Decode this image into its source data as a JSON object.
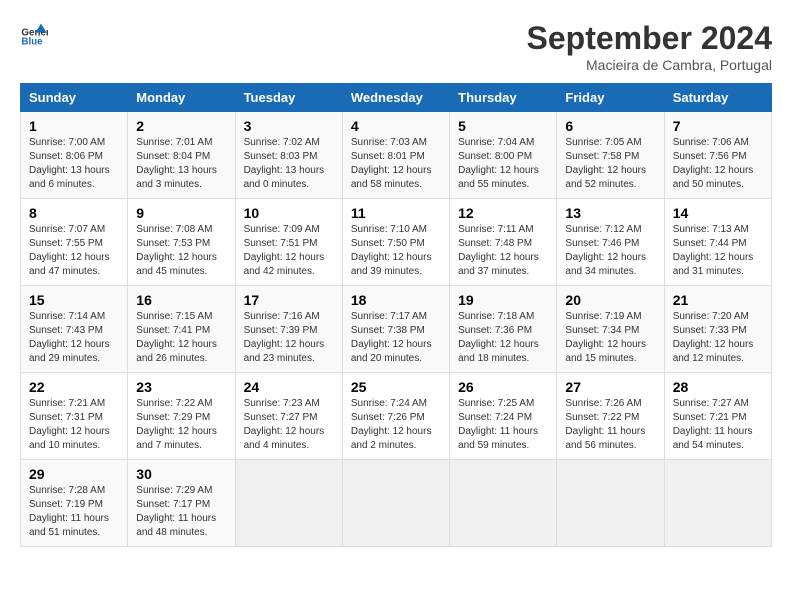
{
  "logo": {
    "line1": "General",
    "line2": "Blue"
  },
  "title": "September 2024",
  "subtitle": "Macieira de Cambra, Portugal",
  "weekdays": [
    "Sunday",
    "Monday",
    "Tuesday",
    "Wednesday",
    "Thursday",
    "Friday",
    "Saturday"
  ],
  "weeks": [
    [
      {
        "day": "1",
        "sunrise": "7:00 AM",
        "sunset": "8:06 PM",
        "daylight": "13 hours and 6 minutes."
      },
      {
        "day": "2",
        "sunrise": "7:01 AM",
        "sunset": "8:04 PM",
        "daylight": "13 hours and 3 minutes."
      },
      {
        "day": "3",
        "sunrise": "7:02 AM",
        "sunset": "8:03 PM",
        "daylight": "13 hours and 0 minutes."
      },
      {
        "day": "4",
        "sunrise": "7:03 AM",
        "sunset": "8:01 PM",
        "daylight": "12 hours and 58 minutes."
      },
      {
        "day": "5",
        "sunrise": "7:04 AM",
        "sunset": "8:00 PM",
        "daylight": "12 hours and 55 minutes."
      },
      {
        "day": "6",
        "sunrise": "7:05 AM",
        "sunset": "7:58 PM",
        "daylight": "12 hours and 52 minutes."
      },
      {
        "day": "7",
        "sunrise": "7:06 AM",
        "sunset": "7:56 PM",
        "daylight": "12 hours and 50 minutes."
      }
    ],
    [
      {
        "day": "8",
        "sunrise": "7:07 AM",
        "sunset": "7:55 PM",
        "daylight": "12 hours and 47 minutes."
      },
      {
        "day": "9",
        "sunrise": "7:08 AM",
        "sunset": "7:53 PM",
        "daylight": "12 hours and 45 minutes."
      },
      {
        "day": "10",
        "sunrise": "7:09 AM",
        "sunset": "7:51 PM",
        "daylight": "12 hours and 42 minutes."
      },
      {
        "day": "11",
        "sunrise": "7:10 AM",
        "sunset": "7:50 PM",
        "daylight": "12 hours and 39 minutes."
      },
      {
        "day": "12",
        "sunrise": "7:11 AM",
        "sunset": "7:48 PM",
        "daylight": "12 hours and 37 minutes."
      },
      {
        "day": "13",
        "sunrise": "7:12 AM",
        "sunset": "7:46 PM",
        "daylight": "12 hours and 34 minutes."
      },
      {
        "day": "14",
        "sunrise": "7:13 AM",
        "sunset": "7:44 PM",
        "daylight": "12 hours and 31 minutes."
      }
    ],
    [
      {
        "day": "15",
        "sunrise": "7:14 AM",
        "sunset": "7:43 PM",
        "daylight": "12 hours and 29 minutes."
      },
      {
        "day": "16",
        "sunrise": "7:15 AM",
        "sunset": "7:41 PM",
        "daylight": "12 hours and 26 minutes."
      },
      {
        "day": "17",
        "sunrise": "7:16 AM",
        "sunset": "7:39 PM",
        "daylight": "12 hours and 23 minutes."
      },
      {
        "day": "18",
        "sunrise": "7:17 AM",
        "sunset": "7:38 PM",
        "daylight": "12 hours and 20 minutes."
      },
      {
        "day": "19",
        "sunrise": "7:18 AM",
        "sunset": "7:36 PM",
        "daylight": "12 hours and 18 minutes."
      },
      {
        "day": "20",
        "sunrise": "7:19 AM",
        "sunset": "7:34 PM",
        "daylight": "12 hours and 15 minutes."
      },
      {
        "day": "21",
        "sunrise": "7:20 AM",
        "sunset": "7:33 PM",
        "daylight": "12 hours and 12 minutes."
      }
    ],
    [
      {
        "day": "22",
        "sunrise": "7:21 AM",
        "sunset": "7:31 PM",
        "daylight": "12 hours and 10 minutes."
      },
      {
        "day": "23",
        "sunrise": "7:22 AM",
        "sunset": "7:29 PM",
        "daylight": "12 hours and 7 minutes."
      },
      {
        "day": "24",
        "sunrise": "7:23 AM",
        "sunset": "7:27 PM",
        "daylight": "12 hours and 4 minutes."
      },
      {
        "day": "25",
        "sunrise": "7:24 AM",
        "sunset": "7:26 PM",
        "daylight": "12 hours and 2 minutes."
      },
      {
        "day": "26",
        "sunrise": "7:25 AM",
        "sunset": "7:24 PM",
        "daylight": "11 hours and 59 minutes."
      },
      {
        "day": "27",
        "sunrise": "7:26 AM",
        "sunset": "7:22 PM",
        "daylight": "11 hours and 56 minutes."
      },
      {
        "day": "28",
        "sunrise": "7:27 AM",
        "sunset": "7:21 PM",
        "daylight": "11 hours and 54 minutes."
      }
    ],
    [
      {
        "day": "29",
        "sunrise": "7:28 AM",
        "sunset": "7:19 PM",
        "daylight": "11 hours and 51 minutes."
      },
      {
        "day": "30",
        "sunrise": "7:29 AM",
        "sunset": "7:17 PM",
        "daylight": "11 hours and 48 minutes."
      },
      null,
      null,
      null,
      null,
      null
    ]
  ]
}
